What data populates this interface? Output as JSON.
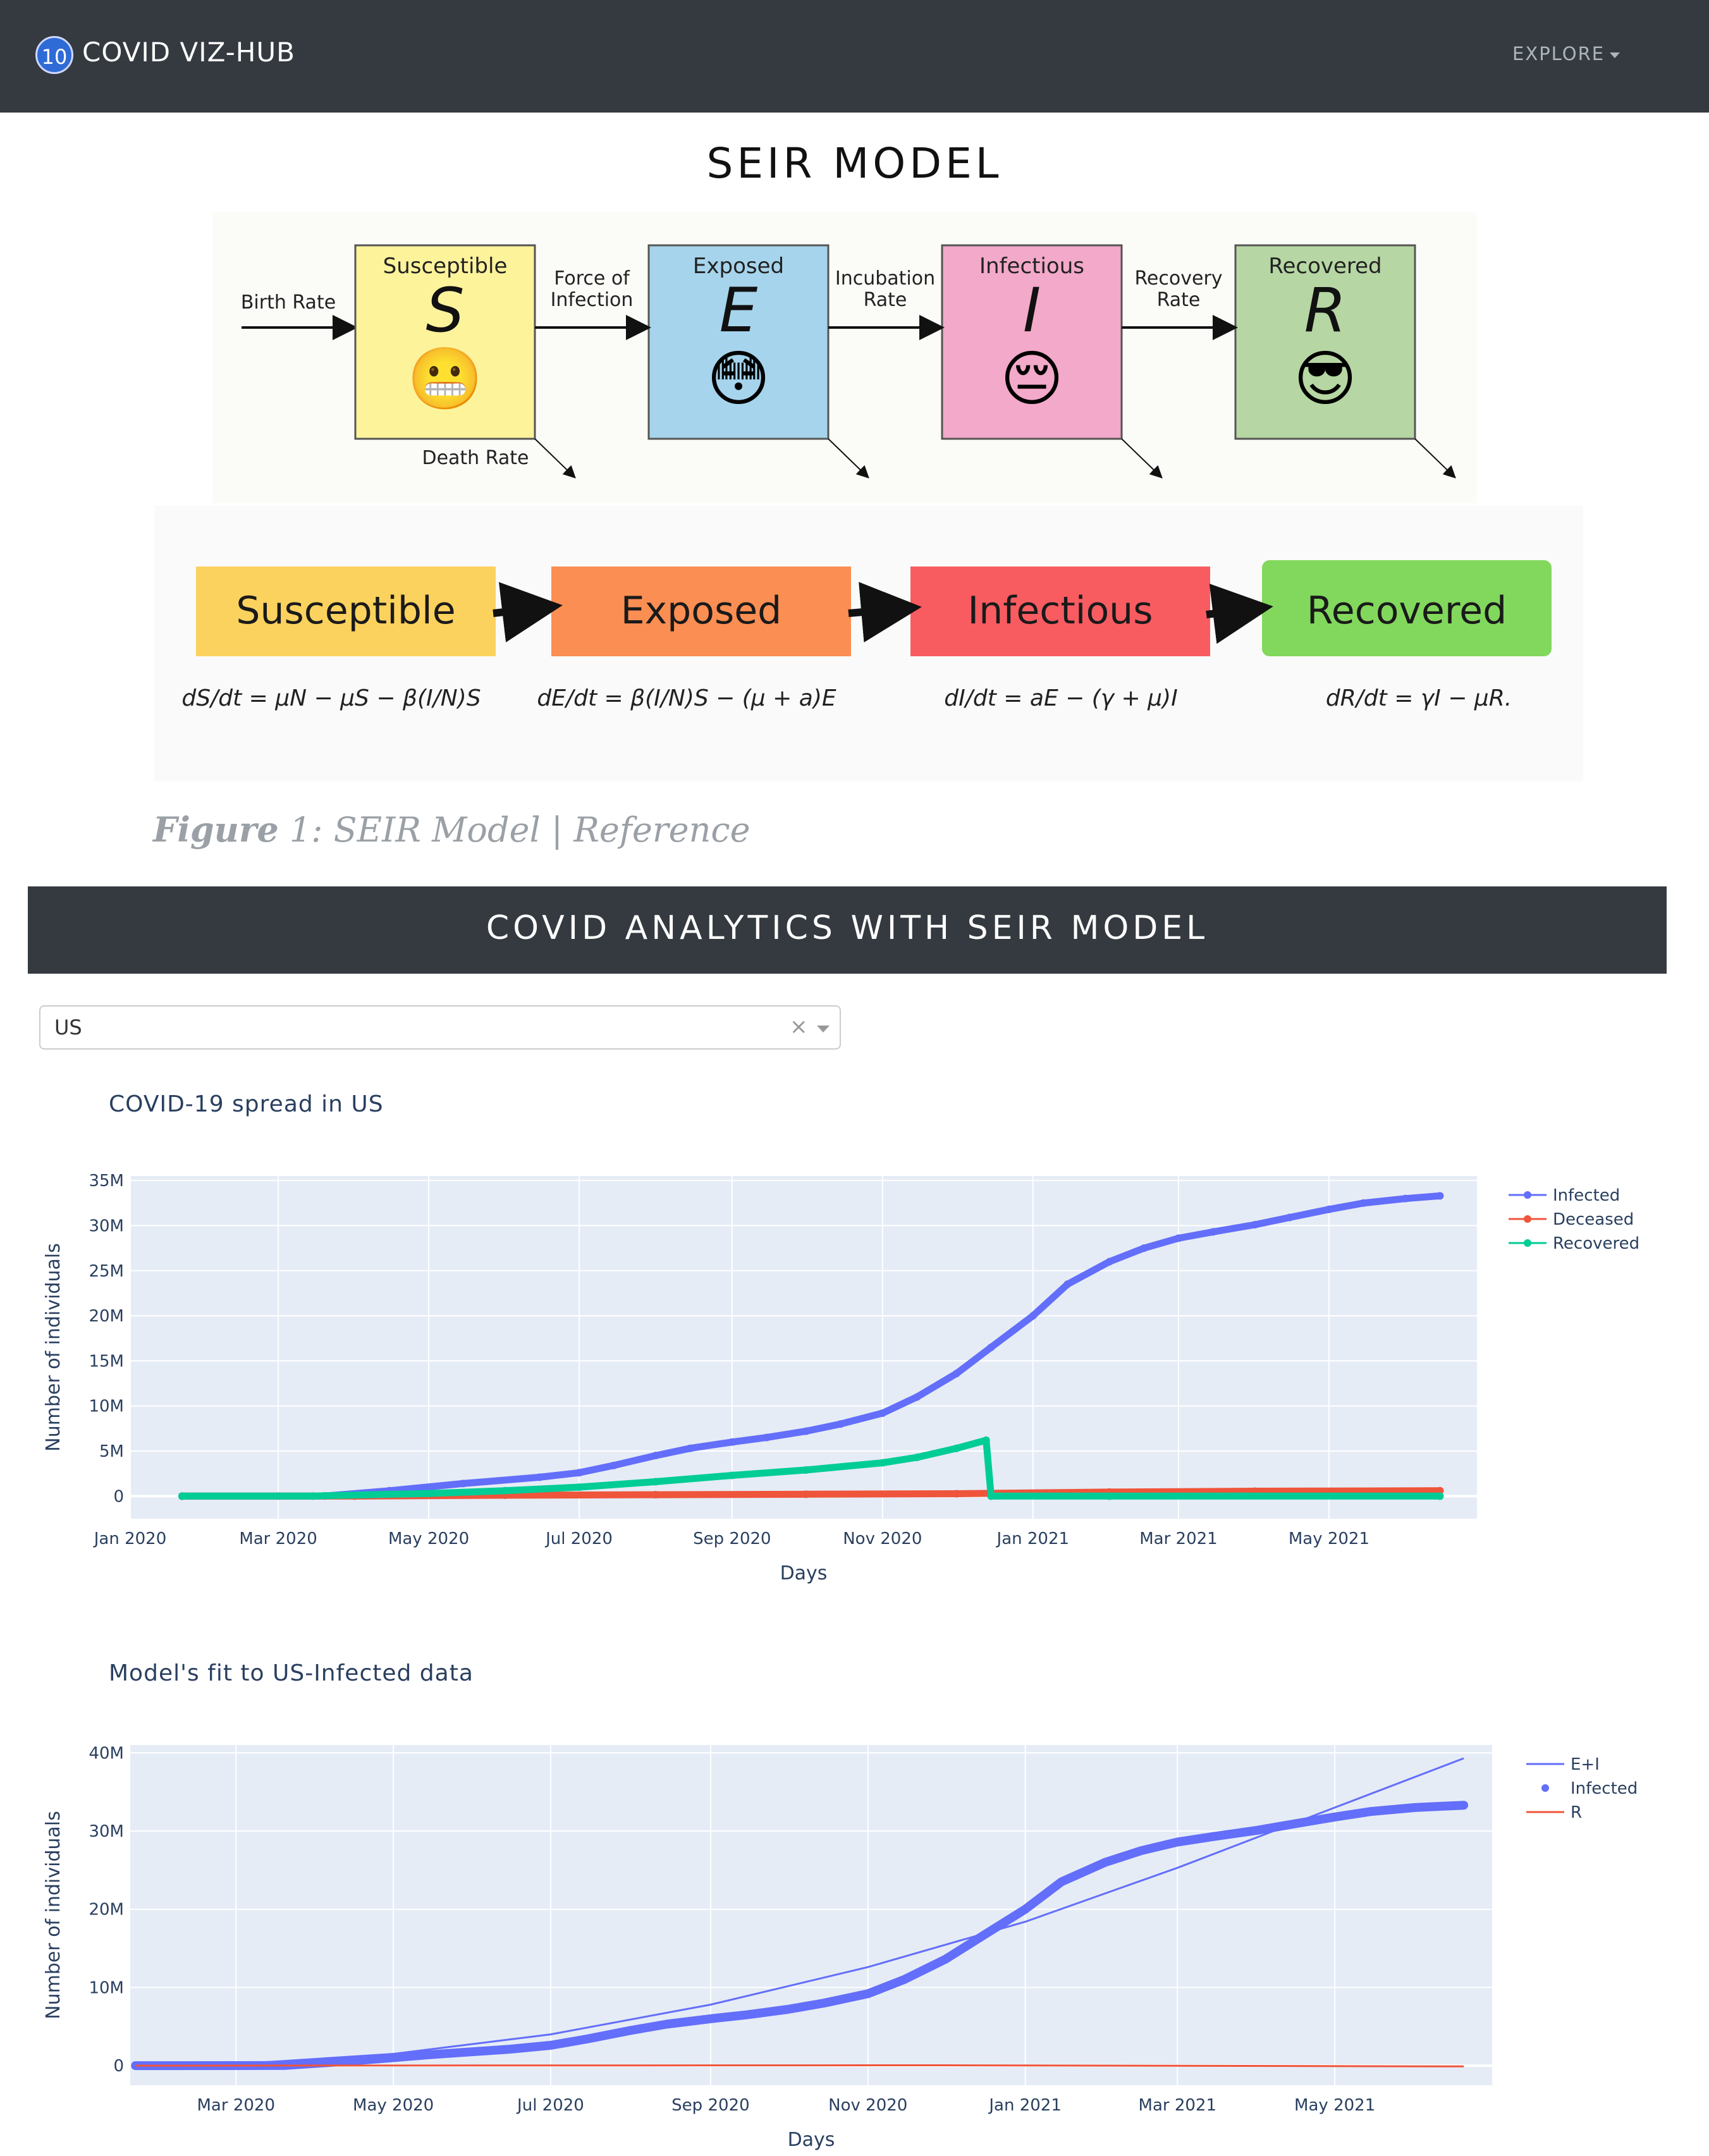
{
  "navbar": {
    "badge": "10",
    "brand": "COVID VIZ-HUB",
    "explore": "EXPLORE"
  },
  "page_title": "SEIR MODEL",
  "diagram": {
    "inflow": "Birth Rate",
    "death_label": "Death Rate",
    "boxes": [
      {
        "name": "Susceptible",
        "letter": "S",
        "emoji": "😬",
        "color": "#fdf39b"
      },
      {
        "name": "Exposed",
        "letter": "E",
        "emoji": "😳",
        "color": "#a6d4ec"
      },
      {
        "name": "Infectious",
        "letter": "I",
        "emoji": "😔",
        "color": "#f3a9c9"
      },
      {
        "name": "Recovered",
        "letter": "R",
        "emoji": "😎",
        "color": "#b6d6a3"
      }
    ],
    "transitions": [
      "Force of\nInfection",
      "Incubation\nRate",
      "Recovery\nRate"
    ]
  },
  "equations": {
    "boxes": [
      {
        "name": "Susceptible",
        "color": "#fcd25e"
      },
      {
        "name": "Exposed",
        "color": "#fb8e52"
      },
      {
        "name": "Infectious",
        "color": "#f85c61"
      },
      {
        "name": "Recovered",
        "color": "#82d85d"
      }
    ],
    "formulas": [
      "dS/dt = μN − μS − β(I/N)S",
      "dE/dt = β(I/N)S − (μ + a)E",
      "dI/dt = aE − (γ + μ)I",
      "dR/dt = γI − μR."
    ]
  },
  "figure_caption": {
    "label": "Figure",
    "text": "1: SEIR Model | Reference"
  },
  "section_banner": "COVID ANALYTICS WITH SEIR MODEL",
  "country_select": {
    "value": "US",
    "clear": "×"
  },
  "charts": [
    {
      "title": "COVID-19 spread in US"
    },
    {
      "title": "Model's fit to US-Infected data"
    }
  ],
  "chart_data": [
    {
      "type": "line",
      "title": "COVID-19 spread in US",
      "xlabel": "Days",
      "ylabel": "Number of individuals",
      "x_ticks": [
        "Jan 2020",
        "Mar 2020",
        "May 2020",
        "Jul 2020",
        "Sep 2020",
        "Nov 2020",
        "Jan 2021",
        "Mar 2021",
        "May 2021"
      ],
      "y_ticks": [
        "0",
        "5M",
        "10M",
        "15M",
        "20M",
        "25M",
        "30M",
        "35M"
      ],
      "xlim": [
        "2020-01-01",
        "2021-06-30"
      ],
      "ylim": [
        -2.5,
        35.5
      ],
      "y_unit": "millions",
      "legend": "top-right",
      "grid": true,
      "series": [
        {
          "name": "Infected",
          "color": "#636efa",
          "mode": "lines+markers",
          "x": [
            "2020-01-22",
            "2020-03-01",
            "2020-03-20",
            "2020-04-15",
            "2020-05-15",
            "2020-06-15",
            "2020-07-01",
            "2020-07-15",
            "2020-08-01",
            "2020-08-15",
            "2020-09-01",
            "2020-09-15",
            "2020-10-01",
            "2020-10-15",
            "2020-11-01",
            "2020-11-15",
            "2020-12-01",
            "2020-12-15",
            "2021-01-01",
            "2021-01-15",
            "2021-02-01",
            "2021-02-15",
            "2021-03-01",
            "2021-03-15",
            "2021-04-01",
            "2021-04-15",
            "2021-05-01",
            "2021-05-15",
            "2021-06-01",
            "2021-06-15"
          ],
          "y": [
            0,
            0.01,
            0.02,
            0.6,
            1.4,
            2.1,
            2.6,
            3.4,
            4.5,
            5.3,
            6.0,
            6.5,
            7.2,
            8.0,
            9.2,
            11.0,
            13.6,
            16.5,
            20.0,
            23.5,
            26.0,
            27.5,
            28.6,
            29.3,
            30.1,
            30.9,
            31.8,
            32.5,
            33.0,
            33.3
          ]
        },
        {
          "name": "Deceased",
          "color": "#ef553b",
          "mode": "lines+markers",
          "x": [
            "2020-01-22",
            "2020-04-01",
            "2020-06-01",
            "2020-08-01",
            "2020-10-01",
            "2020-12-01",
            "2021-02-01",
            "2021-04-01",
            "2021-06-15"
          ],
          "y": [
            0,
            0.005,
            0.1,
            0.16,
            0.21,
            0.27,
            0.45,
            0.55,
            0.6
          ]
        },
        {
          "name": "Recovered",
          "color": "#00cc96",
          "mode": "lines+markers",
          "x": [
            "2020-01-22",
            "2020-03-15",
            "2020-05-01",
            "2020-06-01",
            "2020-07-01",
            "2020-08-01",
            "2020-09-01",
            "2020-10-01",
            "2020-11-01",
            "2020-11-15",
            "2020-12-01",
            "2020-12-13",
            "2020-12-15",
            "2021-02-01",
            "2021-06-15"
          ],
          "y": [
            0,
            0.01,
            0.3,
            0.6,
            1.0,
            1.6,
            2.3,
            2.9,
            3.7,
            4.3,
            5.3,
            6.2,
            0,
            0,
            0
          ]
        }
      ]
    },
    {
      "type": "line",
      "title": "Model's fit to US-Infected data",
      "xlabel": "Days",
      "ylabel": "Number of individuals",
      "x_ticks": [
        "Mar 2020",
        "May 2020",
        "Jul 2020",
        "Sep 2020",
        "Nov 2020",
        "Jan 2021",
        "Mar 2021",
        "May 2021"
      ],
      "y_ticks": [
        "0",
        "10M",
        "20M",
        "30M",
        "40M"
      ],
      "xlim": [
        "2020-01-20",
        "2021-07-01"
      ],
      "ylim": [
        -2.5,
        41
      ],
      "y_unit": "millions",
      "legend": "top-right",
      "grid": true,
      "series": [
        {
          "name": "E+I",
          "color": "#636efa",
          "mode": "lines",
          "x": [
            "2020-01-22",
            "2020-03-01",
            "2020-05-01",
            "2020-07-01",
            "2020-09-01",
            "2020-11-01",
            "2021-01-01",
            "2021-03-01",
            "2021-05-01",
            "2021-06-20"
          ],
          "y": [
            0,
            0.2,
            1.5,
            4.0,
            7.8,
            12.6,
            18.4,
            25.3,
            33.0,
            39.3
          ]
        },
        {
          "name": "Infected",
          "color": "#636efa",
          "mode": "markers",
          "x": [
            "2020-01-22",
            "2020-03-01",
            "2020-03-20",
            "2020-04-15",
            "2020-05-15",
            "2020-06-15",
            "2020-07-01",
            "2020-07-15",
            "2020-08-01",
            "2020-08-15",
            "2020-09-01",
            "2020-09-15",
            "2020-10-01",
            "2020-10-15",
            "2020-11-01",
            "2020-11-15",
            "2020-12-01",
            "2020-12-15",
            "2021-01-01",
            "2021-01-15",
            "2021-02-01",
            "2021-02-15",
            "2021-03-01",
            "2021-03-15",
            "2021-04-01",
            "2021-04-15",
            "2021-05-01",
            "2021-05-15",
            "2021-06-01",
            "2021-06-20"
          ],
          "y": [
            0,
            0.01,
            0.02,
            0.6,
            1.4,
            2.1,
            2.6,
            3.4,
            4.5,
            5.3,
            6.0,
            6.5,
            7.2,
            8.0,
            9.2,
            11.0,
            13.6,
            16.5,
            20.0,
            23.5,
            26.0,
            27.5,
            28.6,
            29.3,
            30.1,
            30.9,
            31.8,
            32.5,
            33.0,
            33.3
          ]
        },
        {
          "name": "R",
          "color": "#ef553b",
          "mode": "lines",
          "x": [
            "2020-01-22",
            "2020-06-01",
            "2020-12-01",
            "2021-06-20"
          ],
          "y": [
            0,
            0.02,
            0.05,
            -0.1
          ]
        }
      ]
    }
  ]
}
